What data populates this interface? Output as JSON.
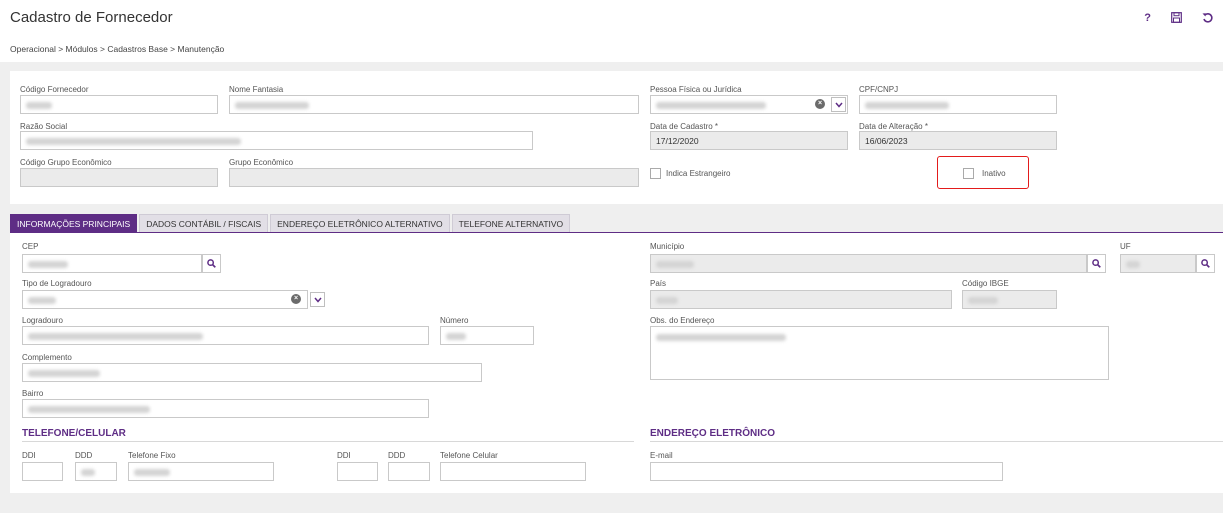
{
  "header": {
    "title": "Cadastro de Fornecedor",
    "help_icon_glyph": "?",
    "breadcrumb": "Operacional  >  Módulos  >  Cadastros Base  >  Manutenção"
  },
  "form": {
    "codigo_fornecedor_label": "Código Fornecedor",
    "nome_fantasia_label": "Nome Fantasia",
    "pessoa_label": "Pessoa Física ou Jurídica",
    "cpf_cnpj_label": "CPF/CNPJ",
    "razao_social_label": "Razão Social",
    "data_cadastro_label": "Data de Cadastro *",
    "data_cadastro_value": "17/12/2020",
    "data_alteracao_label": "Data de Alteração *",
    "data_alteracao_value": "16/06/2023",
    "codigo_grupo_label": "Código Grupo Econômico",
    "grupo_label": "Grupo Econômico",
    "estrangeiro_label": "Indica Estrangeiro",
    "inativo_label": "Inativo"
  },
  "tabs": [
    {
      "label": "INFORMAÇÕES PRINCIPAIS"
    },
    {
      "label": "DADOS CONTÁBIL / FISCAIS"
    },
    {
      "label": "ENDEREÇO ELETRÔNICO ALTERNATIVO"
    },
    {
      "label": "TELEFONE ALTERNATIVO"
    }
  ],
  "address": {
    "cep_label": "CEP",
    "municipio_label": "Município",
    "uf_label": "UF",
    "tipo_logradouro_label": "Tipo de Logradouro",
    "pais_label": "País",
    "codigo_ibge_label": "Código IBGE",
    "logradouro_label": "Logradouro",
    "numero_label": "Número",
    "obs_label": "Obs. do Endereço",
    "complemento_label": "Complemento",
    "bairro_label": "Bairro"
  },
  "phone": {
    "title": "TELEFONE/CELULAR",
    "ddi_label": "DDI",
    "ddd_label": "DDD",
    "fixo_label": "Telefone Fixo",
    "ddi2_label": "DDI",
    "ddd2_label": "DDD",
    "celular_label": "Telefone Celular"
  },
  "email": {
    "title": "ENDEREÇO ELETRÔNICO",
    "label": "E-mail"
  },
  "colors": {
    "accent": "#5e2d85",
    "highlight": "#e31b1b"
  }
}
